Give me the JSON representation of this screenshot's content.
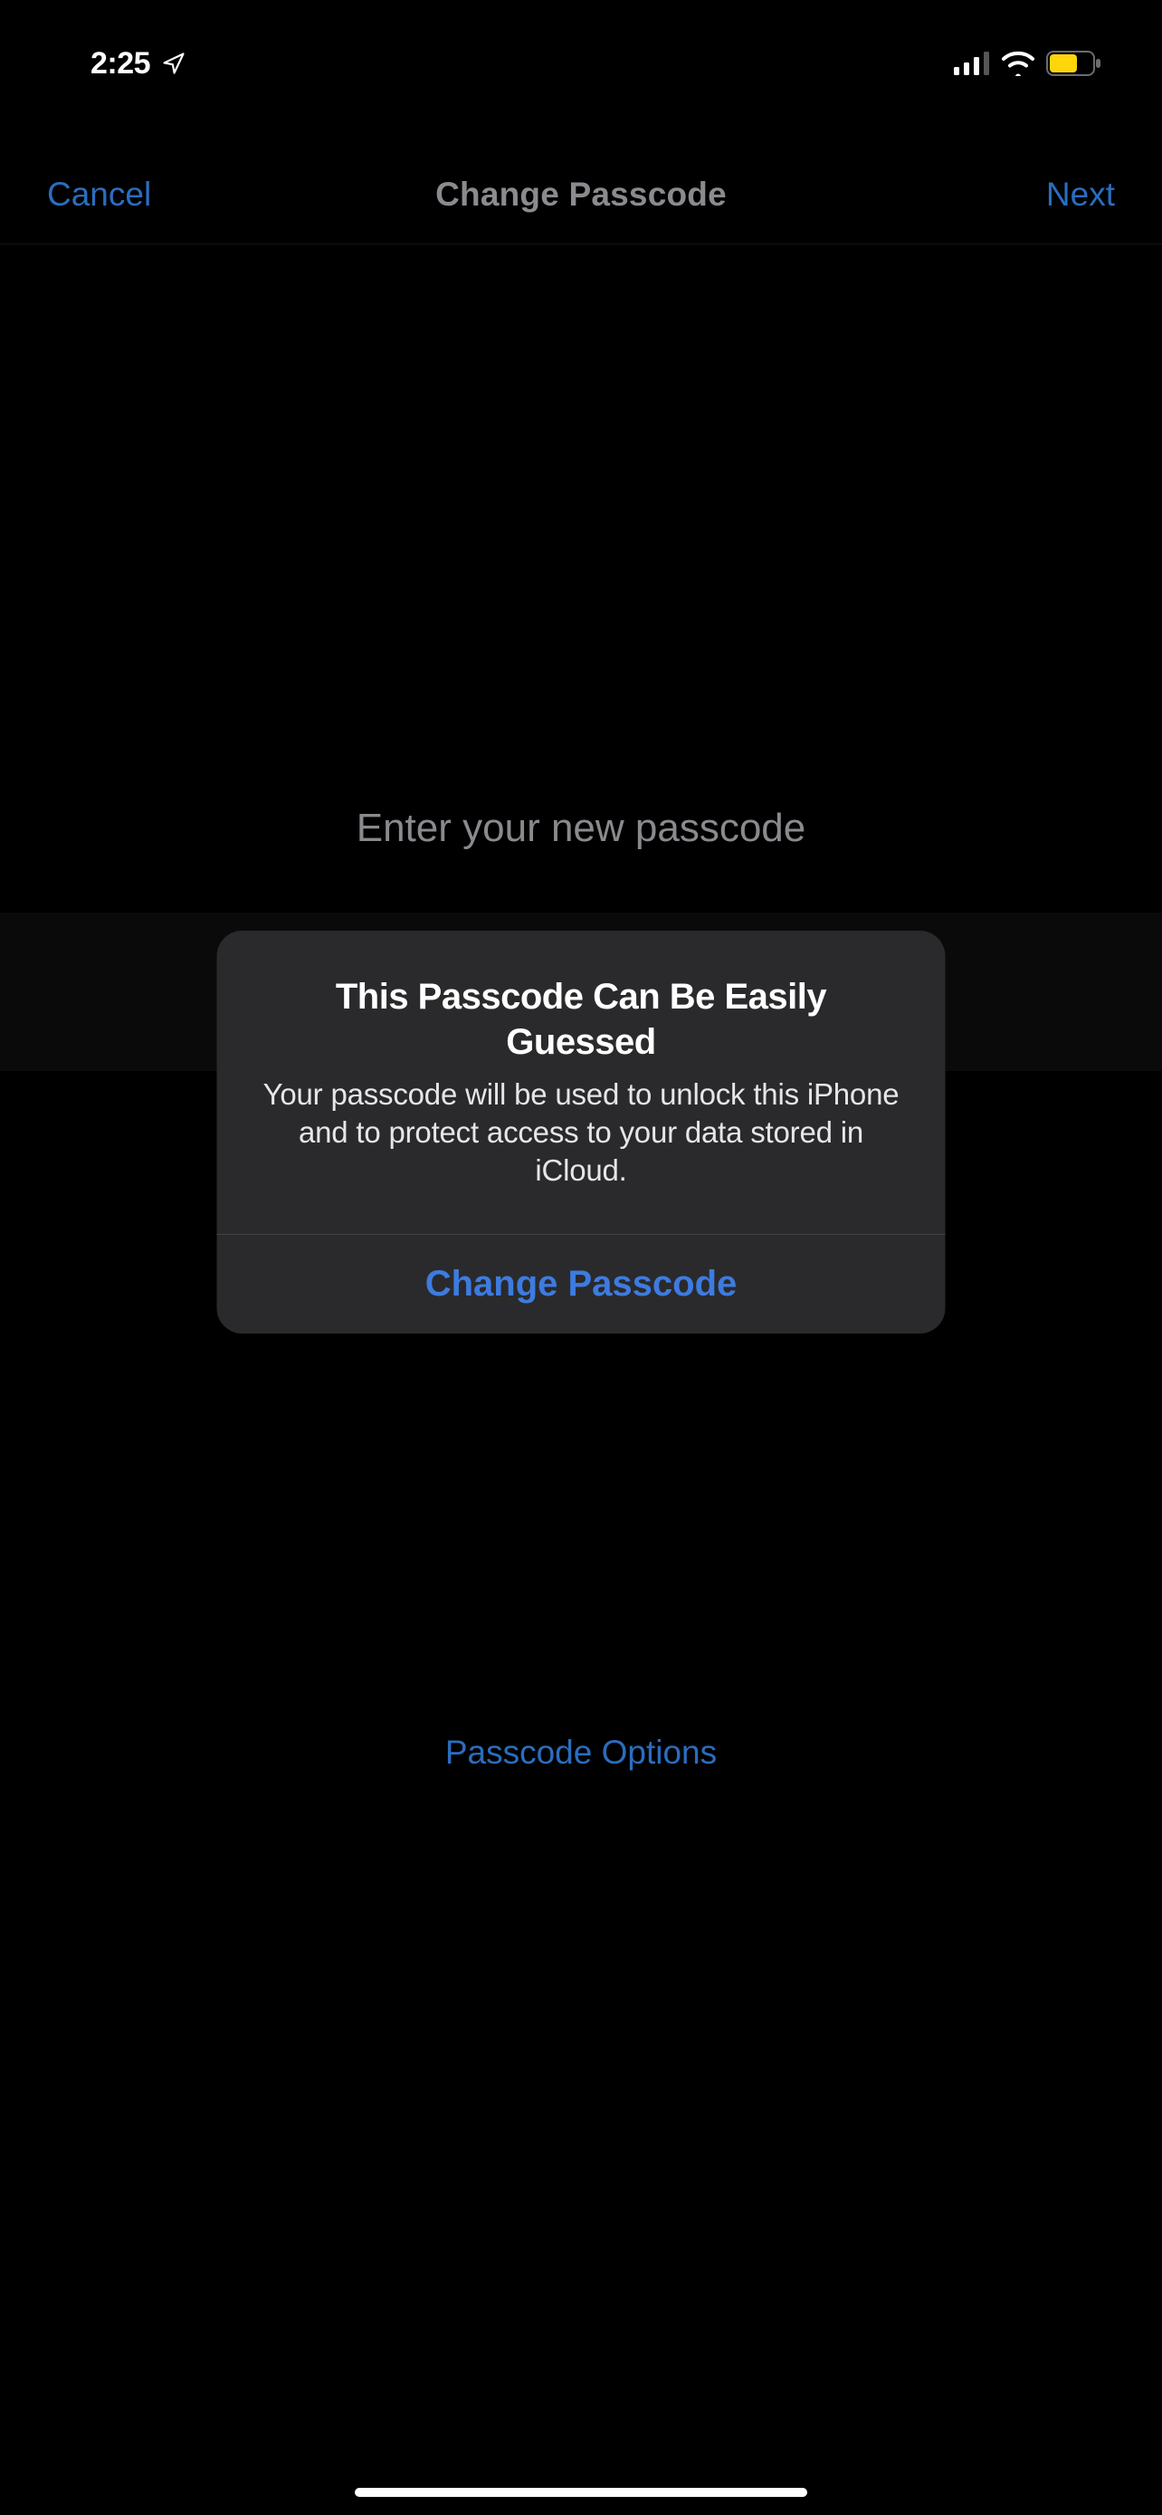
{
  "status": {
    "time": "2:25"
  },
  "nav": {
    "cancel_label": "Cancel",
    "title": "Change Passcode",
    "next_label": "Next"
  },
  "content": {
    "prompt": "Enter your new passcode",
    "options_label": "Passcode Options"
  },
  "alert": {
    "title": "This Passcode Can Be Easily Guessed",
    "message": "Your passcode will be used to unlock this iPhone and to protect access to your data stored in iCloud.",
    "action_label": "Change Passcode"
  }
}
